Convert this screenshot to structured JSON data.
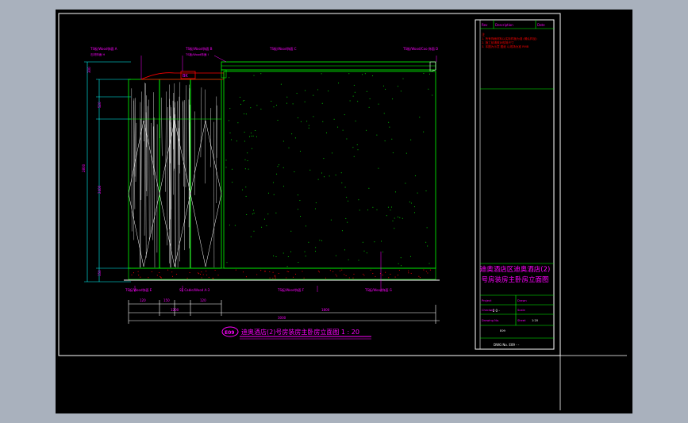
{
  "drawing": {
    "title_main": "迪奥酒店(2)号房装房主卧房立面图 1 : 20",
    "title_badge": "E09",
    "top_labels": [
      "TS板/Wood饰面 A",
      "TS板/Wood饰面 B",
      "TS板/Wood饰面 C",
      "TS板/Wood/Coo 饰面 D"
    ],
    "bottom_labels": [
      "TS板/Wood饰面 E",
      "SS Cable/Wood A-3",
      "TS板/Wood饰面 F",
      "TS板/Wood饰面 G"
    ],
    "sub_labels": [
      "石材饰面 H",
      "TS板/Wood饰面 I"
    ],
    "callout_tag": "BK",
    "dim_top": [
      "120",
      "150",
      "120",
      "1200"
    ],
    "dim_mid": [
      "1200",
      "1800"
    ],
    "dim_total": "3000",
    "dim_vertical_outer": "2800",
    "dim_vertical_inner": [
      "300",
      "520",
      "1500",
      "150"
    ],
    "dim_vertical_total": "2400"
  },
  "title_block": {
    "header_cells": [
      "Rev",
      "Description",
      "Date"
    ],
    "notes": [
      "注",
      "1. 所有饰面材料以实际样板为准 (确认样品)",
      "  2. 施工前请核对现场尺寸",
      "3. 本图为示意 图纸 以现场为准 RMB"
    ],
    "project_name": "迪奥酒店区迪奥酒店(2)号房装房主卧房立面图",
    "fields": [
      "Project",
      "Drawn",
      "Checked",
      "Scale",
      "Drawing No.",
      "Sheet"
    ],
    "values": [
      "- 2 0 -",
      "1:20",
      "E09"
    ],
    "footer": "DWG No. E09 - -"
  },
  "colors": {
    "background": "#000000",
    "frame": "#ffffff",
    "lines": "#00ff00",
    "dims": "#00ffff",
    "text": "#ff00ff",
    "accent": "#ff0000",
    "dots": "#00ff00"
  }
}
